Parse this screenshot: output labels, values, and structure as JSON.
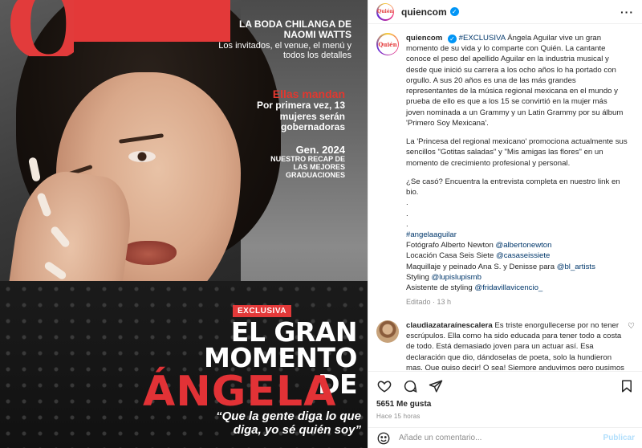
{
  "cover": {
    "logo_letter": "Q",
    "headline1": "LA BODA CHILANGA DE NAOMI WATTS",
    "headline1_sub": "Los invitados, el venue, el menú y todos los detalles",
    "headline2_red": "Ellas mandan",
    "headline2_sub": "Por primera vez, 13 mujeres serán gobernadoras",
    "headline3_big": "Gen. 2024",
    "headline3_sub": "NUESTRO RECAP DE LAS MEJORES GRADUACIONES",
    "badge": "EXCLUSIVA",
    "title_line1": "EL GRAN",
    "title_line2": "MOMENTO DE",
    "title_name": "ÁNGELA",
    "quote": "“Que la gente diga lo que diga, yo sé quién soy”"
  },
  "post": {
    "header_username": "quiencom",
    "avatar_text": "Quién",
    "more_label": "···",
    "caption": {
      "username": "quiencom",
      "p1_tag": "#EXCLUSIVA",
      "p1": "Ángela Aguilar vive un gran momento de su vida y lo comparte con Quién. La cantante conoce el peso del apellido Aguilar en la industria musical y desde que inició su carrera a los ocho años lo ha portado con orgullo. A sus 20 años es una de las más grandes representantes de la música regional mexicana en el mundo y prueba de ello es que a los 15 se convirtió en la mujer más joven nominada a un Grammy y un Latin Grammy por su álbum 'Primero Soy Mexicana'.",
      "p2": "La 'Princesa del regional mexicano' promociona actualmente sus sencillos \"Gotitas saladas\" y \"Mis amigas las flores\" en un momento de crecimiento profesional y personal.",
      "p3": "¿Se casó? Encuentra la entrevista completa en nuestro link en bio.",
      "dots": [
        ".",
        ".",
        "."
      ],
      "hashtag": "#angelaaguilar",
      "credits": [
        {
          "label": "Fotógrafo Alberto Newton",
          "mention": "@albertonewton"
        },
        {
          "label": "Locación Casa Seis Siete",
          "mention": "@casaseissiete"
        },
        {
          "label": "Maquillaje y peinado Ana S. y Denisse para",
          "mention": "@bl_artists"
        },
        {
          "label": "Styling",
          "mention": "@lupislupismb"
        },
        {
          "label": "Asistente de styling",
          "mention": "@fridavillavicencio_"
        }
      ],
      "edited": "Editado · 13 h"
    },
    "comment": {
      "username": "claudiazataraínescalera",
      "text": "Es triste enorgullecerse por no tener escrúpulos. Ella como ha sido educada para tener todo a costa de todo. Está demasiado joven para un actuar así. Esa declaración que dio, dándoselas de poeta, solo la hundieron mas. Que quiso decir! O sea! Siempre anduvimos pero pusimos una pausa, y en"
    },
    "likes": "5651 Me gusta",
    "time": "Hace 15 horas",
    "add_comment_placeholder": "Añade un comentario...",
    "publish_label": "Publicar"
  },
  "icons": [
    "heart-icon",
    "comment-icon",
    "share-icon",
    "bookmark-icon",
    "emoji-icon",
    "verified-badge-icon",
    "more-options-icon"
  ],
  "colors": {
    "brand_red": "#e33939",
    "link": "#00376b",
    "verified": "#0095f6",
    "muted": "#8e8e8e",
    "publish_disabled": "#b2dffc"
  }
}
